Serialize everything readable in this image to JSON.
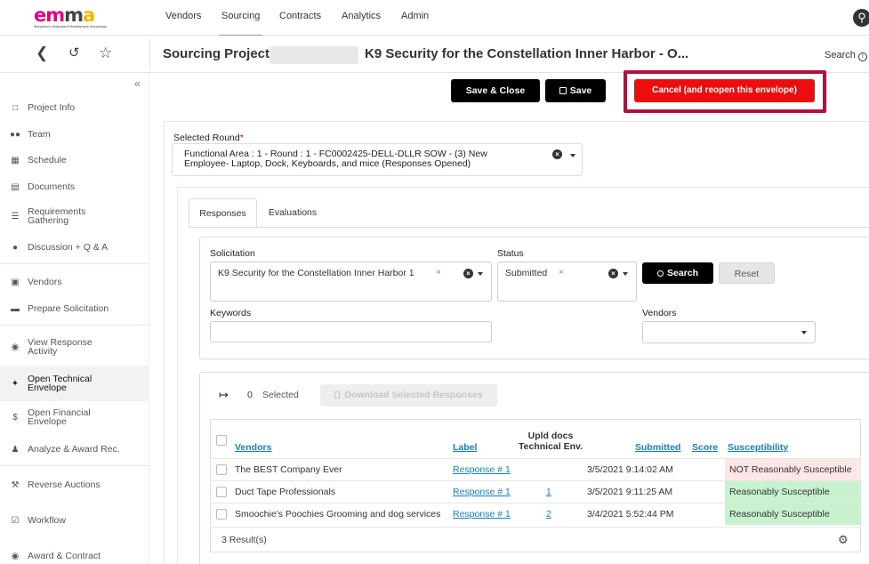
{
  "app": {
    "logo_text": "emma",
    "logo_subtitle": "Maryland's eMaryland Marketplace Advantage",
    "nav": [
      "Vendors",
      "Sourcing",
      "Contracts",
      "Analytics",
      "Admin"
    ],
    "active_nav": "Sourcing",
    "accessibility_icon": "accessibility-icon"
  },
  "subbar": {
    "icons": [
      "back-arrow-icon",
      "history-icon",
      "star-icon"
    ],
    "label": "Sourcing Project:",
    "title": "K9 Security for the Constellation Inner Harbor - O...",
    "search_label": "Search",
    "search_icon": "info-icon"
  },
  "sidebar": {
    "collapse_icon": "«",
    "items": [
      {
        "label": "Project Info",
        "icon": "clipboard-icon"
      },
      {
        "label": "Team",
        "icon": "team-icon"
      },
      {
        "label": "Schedule",
        "icon": "calendar-icon"
      },
      {
        "label": "Documents",
        "icon": "document-icon"
      },
      {
        "label": "Requirements Gathering",
        "icon": "list-icon"
      },
      {
        "label": "Discussion + Q & A",
        "icon": "chat-icon"
      },
      {
        "label": "Vendors",
        "icon": "truck-icon"
      },
      {
        "label": "Prepare Solicitation",
        "icon": "folder-icon"
      },
      {
        "label": "View Response Activity",
        "icon": "binoculars-icon"
      },
      {
        "label": "Open Technical Envelope",
        "icon": "wrench-icon"
      },
      {
        "label": "Open Financial Envelope",
        "icon": "dollar-icon"
      },
      {
        "label": "Analyze & Award Rec.",
        "icon": "trophy-icon"
      },
      {
        "label": "Reverse Auctions",
        "icon": "gavel-icon"
      },
      {
        "label": "Workflow",
        "icon": "checkbox-icon"
      },
      {
        "label": "Award & Contract",
        "icon": "award-icon"
      }
    ],
    "active": "Open Technical Envelope"
  },
  "toolbar": {
    "save_close": "Save & Close",
    "save": "Save",
    "save_icon": "save-icon",
    "cancel": "Cancel (and reopen this envelope)"
  },
  "round": {
    "label": "Selected Round",
    "required": "*",
    "value": "Functional Area : 1 - Round : 1 - FC0002425-DELL-DLLR SOW - (3) New Employee- Laptop, Dock, Keyboards, and mice (Responses Opened)"
  },
  "tabs": [
    "Responses",
    "Evaluations"
  ],
  "active_tab": "Responses",
  "filters": {
    "solicitation_label": "Solicitation",
    "solicitation_value": "K9 Security for the Constellation Inner Harbor 1",
    "status_label": "Status",
    "status_value": "Submitted",
    "keywords_label": "Keywords",
    "keywords_value": "",
    "vendors_label": "Vendors",
    "vendors_value": "",
    "search_button": "Search",
    "reset_button": "Reset"
  },
  "results": {
    "selected_count": "0",
    "selected_label": "Selected",
    "download_button": "Download Selected Responses",
    "columns": {
      "vendors": "Vendors",
      "label": "Label",
      "upld_docs_line1": "Upld docs",
      "upld_docs_line2": "Technical Env.",
      "submitted": "Submitted",
      "score": "Score",
      "susceptibility": "Susceptibility"
    },
    "rows": [
      {
        "vendor": "The BEST Company Ever",
        "label": "Response # 1",
        "docs": "",
        "submitted": "3/5/2021 9:14:02 AM",
        "score": "",
        "susceptibility": "NOT Reasonably Susceptible",
        "status": "red"
      },
      {
        "vendor": "Duct Tape Professionals",
        "label": "Response # 1",
        "docs": "1",
        "submitted": "3/5/2021 9:11:25 AM",
        "score": "",
        "susceptibility": "Reasonably Susceptible",
        "status": "green"
      },
      {
        "vendor": "Smoochie's Poochies Grooming and dog services",
        "label": "Response # 1",
        "docs": "2",
        "submitted": "3/4/2021 5:52:44 PM",
        "score": "",
        "susceptibility": "Reasonably Susceptible",
        "status": "green"
      }
    ],
    "result_count": "3 Result(s)"
  },
  "colors": {
    "cancel_red": "#ee0d0d",
    "highlight_frame": "#b0123c",
    "link_blue": "#1a7fc1",
    "susceptible_green": "#c8f2cd",
    "not_susceptible_red": "#fde6e6"
  }
}
